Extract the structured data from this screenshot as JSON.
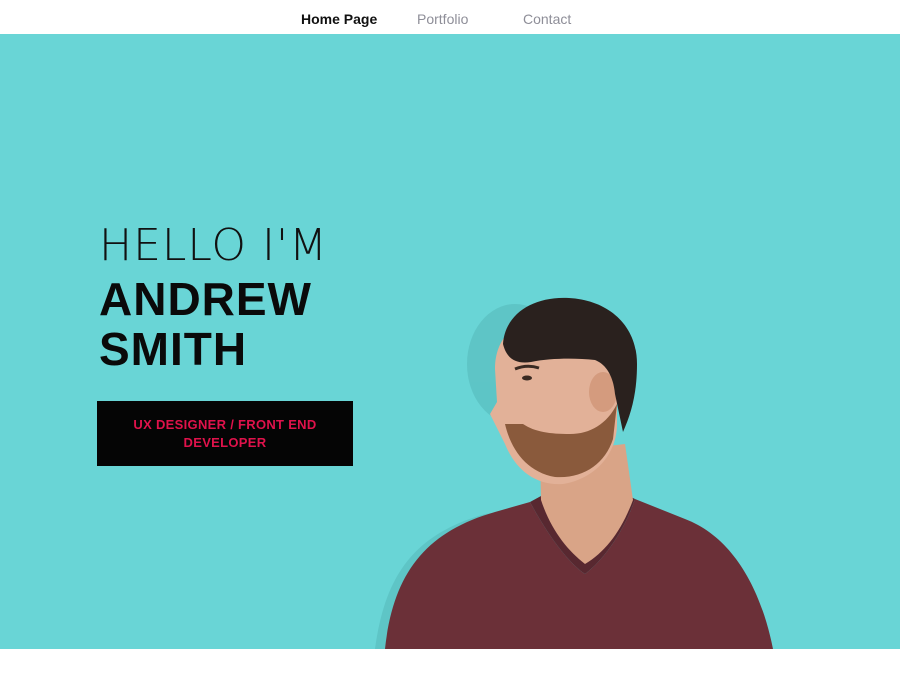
{
  "nav": {
    "items": [
      {
        "label": "Home Page",
        "active": true
      },
      {
        "label": "Portfolio",
        "active": false
      },
      {
        "label": "Contact",
        "active": false
      }
    ]
  },
  "hero": {
    "greeting": "HELLO I'M",
    "name_line1": "ANDREW",
    "name_line2": "SMITH",
    "role": "UX DESIGNER / FRONT END DEVELOPER",
    "background_color": "#69d5d6"
  },
  "colors": {
    "accent": "#e0124b",
    "badge_bg": "#050505",
    "nav_inactive": "#8e8e98",
    "nav_active": "#111111"
  },
  "portrait": {
    "description_icon": "person-photo"
  }
}
